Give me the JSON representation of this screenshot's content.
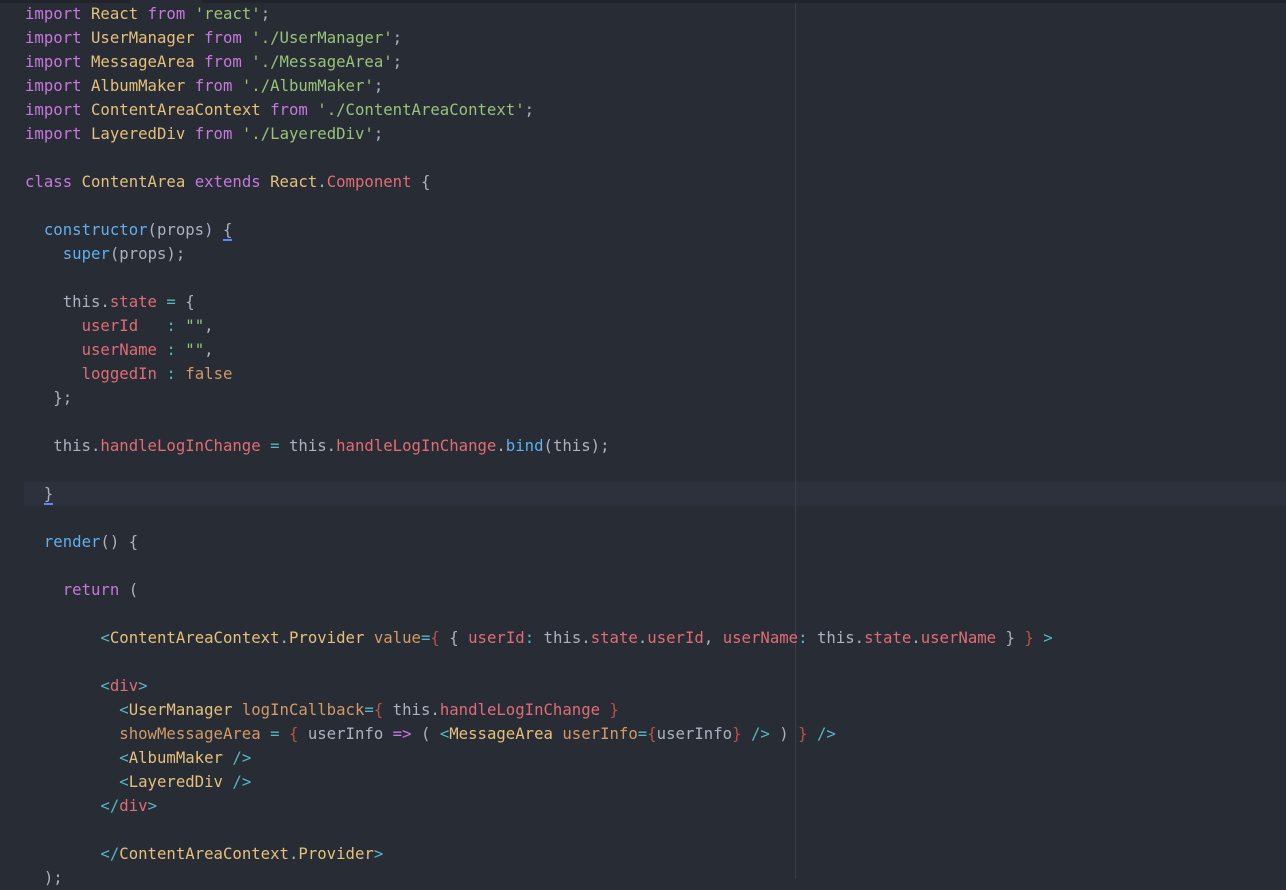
{
  "editor": {
    "theme_colors": {
      "background": "#282c34",
      "keyword": "#c678dd",
      "class": "#e5c07b",
      "string": "#98c379",
      "property": "#e06c75",
      "function": "#61afef",
      "operator": "#56b6c2",
      "attribute": "#d19a66",
      "text": "#abb2bf"
    },
    "lines": [
      [
        [
          "kw",
          "import"
        ],
        [
          "pl",
          " "
        ],
        [
          "cls",
          "React"
        ],
        [
          "pl",
          " "
        ],
        [
          "kw",
          "from"
        ],
        [
          "pl",
          " "
        ],
        [
          "str",
          "'react'"
        ],
        [
          "pl",
          ";"
        ]
      ],
      [
        [
          "kw",
          "import"
        ],
        [
          "pl",
          " "
        ],
        [
          "cls",
          "UserManager"
        ],
        [
          "pl",
          " "
        ],
        [
          "kw",
          "from"
        ],
        [
          "pl",
          " "
        ],
        [
          "str",
          "'./UserManager'"
        ],
        [
          "pl",
          ";"
        ]
      ],
      [
        [
          "kw",
          "import"
        ],
        [
          "pl",
          " "
        ],
        [
          "cls",
          "MessageArea"
        ],
        [
          "pl",
          " "
        ],
        [
          "kw",
          "from"
        ],
        [
          "pl",
          " "
        ],
        [
          "str",
          "'./MessageArea'"
        ],
        [
          "pl",
          ";"
        ]
      ],
      [
        [
          "kw",
          "import"
        ],
        [
          "pl",
          " "
        ],
        [
          "cls",
          "AlbumMaker"
        ],
        [
          "pl",
          " "
        ],
        [
          "kw",
          "from"
        ],
        [
          "pl",
          " "
        ],
        [
          "str",
          "'./AlbumMaker'"
        ],
        [
          "pl",
          ";"
        ]
      ],
      [
        [
          "kw",
          "import"
        ],
        [
          "pl",
          " "
        ],
        [
          "cls",
          "ContentAreaContext"
        ],
        [
          "pl",
          " "
        ],
        [
          "kw",
          "from"
        ],
        [
          "pl",
          " "
        ],
        [
          "str",
          "'./ContentAreaContext'"
        ],
        [
          "pl",
          ";"
        ]
      ],
      [
        [
          "kw",
          "import"
        ],
        [
          "pl",
          " "
        ],
        [
          "cls",
          "LayeredDiv"
        ],
        [
          "pl",
          " "
        ],
        [
          "kw",
          "from"
        ],
        [
          "pl",
          " "
        ],
        [
          "str",
          "'./LayeredDiv'"
        ],
        [
          "pl",
          ";"
        ]
      ],
      [],
      [
        [
          "kw",
          "class"
        ],
        [
          "pl",
          " "
        ],
        [
          "cls",
          "ContentArea"
        ],
        [
          "pl",
          " "
        ],
        [
          "kw",
          "extends"
        ],
        [
          "pl",
          " "
        ],
        [
          "cls",
          "React"
        ],
        [
          "pl",
          "."
        ],
        [
          "prop",
          "Component"
        ],
        [
          "pl",
          " {"
        ]
      ],
      [],
      [
        [
          "pl",
          "  "
        ],
        [
          "fn",
          "constructor"
        ],
        [
          "pl",
          "(props) "
        ],
        [
          "pl",
          "{",
          "match"
        ]
      ],
      [
        [
          "pl",
          "    "
        ],
        [
          "fn",
          "super"
        ],
        [
          "pl",
          "(props);"
        ]
      ],
      [],
      [
        [
          "pl",
          "    this."
        ],
        [
          "prop",
          "state"
        ],
        [
          "pl",
          " "
        ],
        [
          "op",
          "="
        ],
        [
          "pl",
          " {"
        ]
      ],
      [
        [
          "pl",
          "      "
        ],
        [
          "prop",
          "userId"
        ],
        [
          "pl",
          "   "
        ],
        [
          "op",
          ":"
        ],
        [
          "pl",
          " "
        ],
        [
          "str",
          "\"\""
        ],
        [
          "pl",
          ","
        ]
      ],
      [
        [
          "pl",
          "      "
        ],
        [
          "prop",
          "userName"
        ],
        [
          "pl",
          " "
        ],
        [
          "op",
          ":"
        ],
        [
          "pl",
          " "
        ],
        [
          "str",
          "\"\""
        ],
        [
          "pl",
          ","
        ]
      ],
      [
        [
          "pl",
          "      "
        ],
        [
          "prop",
          "loggedIn"
        ],
        [
          "pl",
          " "
        ],
        [
          "op",
          ":"
        ],
        [
          "pl",
          " "
        ],
        [
          "attr",
          "false"
        ]
      ],
      [
        [
          "pl",
          "   };"
        ]
      ],
      [],
      [
        [
          "pl",
          "   this."
        ],
        [
          "prop",
          "handleLogInChange"
        ],
        [
          "pl",
          " "
        ],
        [
          "op",
          "="
        ],
        [
          "pl",
          " this."
        ],
        [
          "prop",
          "handleLogInChange"
        ],
        [
          "pl",
          "."
        ],
        [
          "fn",
          "bind"
        ],
        [
          "pl",
          "(this);"
        ]
      ],
      [],
      [
        [
          "pl",
          "  "
        ],
        [
          "pl",
          "}",
          "match"
        ]
      ],
      [],
      [
        [
          "pl",
          "  "
        ],
        [
          "fn",
          "render"
        ],
        [
          "pl",
          "() {"
        ]
      ],
      [],
      [
        [
          "pl",
          "    "
        ],
        [
          "kw",
          "return"
        ],
        [
          "pl",
          " ("
        ]
      ],
      [],
      [
        [
          "pl",
          "        "
        ],
        [
          "op",
          "<"
        ],
        [
          "cls",
          "ContentAreaContext"
        ],
        [
          "pl",
          "."
        ],
        [
          "cls",
          "Provider"
        ],
        [
          "pl",
          " "
        ],
        [
          "attr",
          "value"
        ],
        [
          "op",
          "="
        ],
        [
          "brace",
          "{"
        ],
        [
          "pl",
          " { "
        ],
        [
          "prop",
          "userId"
        ],
        [
          "op",
          ":"
        ],
        [
          "pl",
          " this."
        ],
        [
          "prop",
          "state"
        ],
        [
          "pl",
          "."
        ],
        [
          "prop",
          "userId"
        ],
        [
          "pl",
          ", "
        ],
        [
          "prop",
          "userName"
        ],
        [
          "op",
          ":"
        ],
        [
          "pl",
          " this."
        ],
        [
          "prop",
          "state"
        ],
        [
          "pl",
          "."
        ],
        [
          "prop",
          "userName"
        ],
        [
          "pl",
          " } "
        ],
        [
          "brace",
          "}"
        ],
        [
          "pl",
          " "
        ],
        [
          "op",
          ">"
        ]
      ],
      [],
      [
        [
          "pl",
          "        "
        ],
        [
          "op",
          "<"
        ],
        [
          "prop",
          "div"
        ],
        [
          "op",
          ">"
        ]
      ],
      [
        [
          "pl",
          "          "
        ],
        [
          "op",
          "<"
        ],
        [
          "cls",
          "UserManager"
        ],
        [
          "pl",
          " "
        ],
        [
          "attr",
          "logInCallback"
        ],
        [
          "op",
          "="
        ],
        [
          "brace",
          "{"
        ],
        [
          "pl",
          " this."
        ],
        [
          "prop",
          "handleLogInChange"
        ],
        [
          "pl",
          " "
        ],
        [
          "brace",
          "}"
        ]
      ],
      [
        [
          "pl",
          "          "
        ],
        [
          "attr",
          "showMessageArea"
        ],
        [
          "pl",
          " "
        ],
        [
          "op",
          "="
        ],
        [
          "pl",
          " "
        ],
        [
          "brace",
          "{"
        ],
        [
          "pl",
          " userInfo "
        ],
        [
          "kw",
          "=>"
        ],
        [
          "pl",
          " ( "
        ],
        [
          "op",
          "<"
        ],
        [
          "cls",
          "MessageArea"
        ],
        [
          "pl",
          " "
        ],
        [
          "attr",
          "userInfo"
        ],
        [
          "op",
          "="
        ],
        [
          "brace",
          "{"
        ],
        [
          "pl",
          "userInfo"
        ],
        [
          "brace",
          "}"
        ],
        [
          "pl",
          " "
        ],
        [
          "op",
          "/>"
        ],
        [
          "pl",
          " ) "
        ],
        [
          "brace",
          "}"
        ],
        [
          "pl",
          " "
        ],
        [
          "op",
          "/>"
        ]
      ],
      [
        [
          "pl",
          "          "
        ],
        [
          "op",
          "<"
        ],
        [
          "cls",
          "AlbumMaker"
        ],
        [
          "pl",
          " "
        ],
        [
          "op",
          "/>"
        ]
      ],
      [
        [
          "pl",
          "          "
        ],
        [
          "op",
          "<"
        ],
        [
          "cls",
          "LayeredDiv"
        ],
        [
          "pl",
          " "
        ],
        [
          "op",
          "/>"
        ]
      ],
      [
        [
          "pl",
          "        "
        ],
        [
          "op",
          "</"
        ],
        [
          "prop",
          "div"
        ],
        [
          "op",
          ">"
        ]
      ],
      [],
      [
        [
          "pl",
          "        "
        ],
        [
          "op",
          "</"
        ],
        [
          "cls",
          "ContentAreaContext"
        ],
        [
          "pl",
          "."
        ],
        [
          "cls",
          "Provider"
        ],
        [
          "op",
          ">"
        ]
      ],
      [
        [
          "pl",
          "  );"
        ]
      ]
    ]
  }
}
